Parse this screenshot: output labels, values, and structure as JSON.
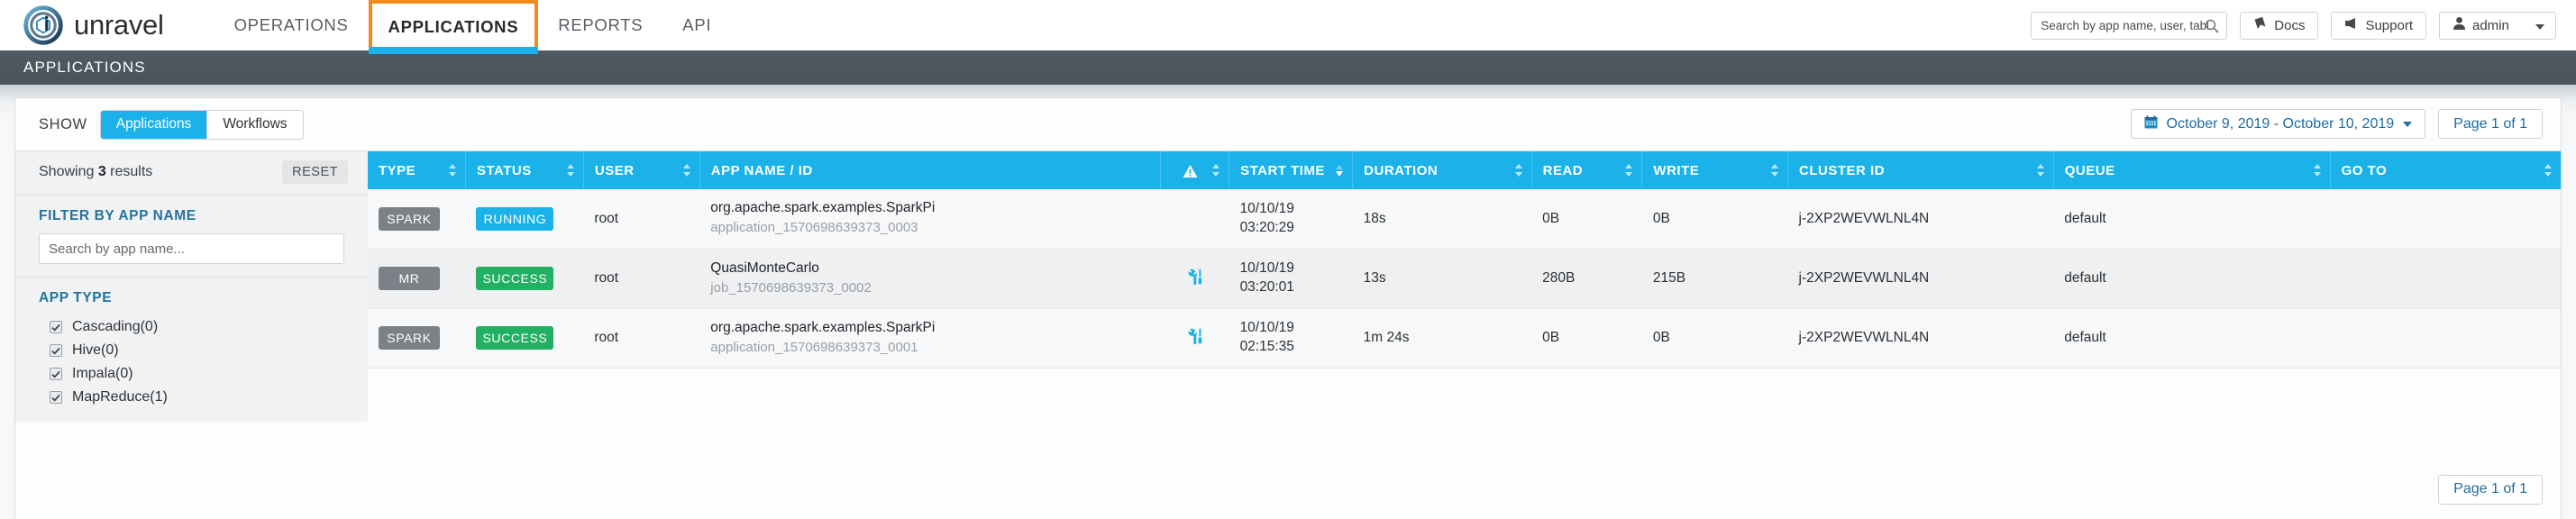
{
  "brand": {
    "name": "unravel",
    "logo_icon": "unravel-logo-icon"
  },
  "topnav": {
    "items": [
      {
        "label": "OPERATIONS",
        "active": false
      },
      {
        "label": "APPLICATIONS",
        "active": true
      },
      {
        "label": "REPORTS",
        "active": false
      },
      {
        "label": "API",
        "active": false
      }
    ],
    "search": {
      "placeholder": "Search by app name, user, table or clust",
      "value": "",
      "icon": "search-icon"
    },
    "docs_button": {
      "label": "Docs",
      "icon": "bookmark-icon"
    },
    "support_button": {
      "label": "Support",
      "icon": "megaphone-icon"
    },
    "user_button": {
      "label": "admin",
      "icon": "user-icon",
      "caret": "chevron-down-icon"
    }
  },
  "page_title": "APPLICATIONS",
  "toolbar": {
    "show_label": "SHOW",
    "segments": [
      {
        "label": "Applications",
        "selected": true
      },
      {
        "label": "Workflows",
        "selected": false
      }
    ],
    "date_range": {
      "label": "October 9, 2019 - October 10, 2019",
      "icon": "calendar-icon",
      "caret": "chevron-down-icon"
    },
    "page_indicator_top": "Page 1 of 1"
  },
  "sidebar": {
    "showing_prefix": "Showing ",
    "showing_count": "3",
    "showing_suffix": " results",
    "reset_label": "RESET",
    "filter_app_name": {
      "heading": "FILTER BY APP NAME",
      "placeholder": "Search by app name...",
      "value": ""
    },
    "app_type": {
      "heading": "APP TYPE",
      "options": [
        {
          "label": "Cascading(0)",
          "checked": true
        },
        {
          "label": "Hive(0)",
          "checked": true
        },
        {
          "label": "Impala(0)",
          "checked": true
        },
        {
          "label": "MapReduce(1)",
          "checked": true
        }
      ]
    }
  },
  "table": {
    "columns": [
      {
        "label": "TYPE",
        "sortable": true,
        "sort": "none"
      },
      {
        "label": "STATUS",
        "sortable": true,
        "sort": "none"
      },
      {
        "label": "USER",
        "sortable": true,
        "sort": "none"
      },
      {
        "label": "APP NAME / ID",
        "sortable": false,
        "sort": "none"
      },
      {
        "label": "",
        "icon": "warning-triangle-icon",
        "sortable": true,
        "sort": "none"
      },
      {
        "label": "START TIME",
        "sortable": true,
        "sort": "desc"
      },
      {
        "label": "DURATION",
        "sortable": true,
        "sort": "none"
      },
      {
        "label": "READ",
        "sortable": true,
        "sort": "none"
      },
      {
        "label": "WRITE",
        "sortable": true,
        "sort": "none"
      },
      {
        "label": "CLUSTER ID",
        "sortable": true,
        "sort": "none"
      },
      {
        "label": "QUEUE",
        "sortable": true,
        "sort": "none"
      },
      {
        "label": "GO TO",
        "sortable": true,
        "sort": "none"
      }
    ],
    "rows": [
      {
        "type": "SPARK",
        "status": "RUNNING",
        "status_kind": "running",
        "user": "root",
        "app_name": "org.apache.spark.examples.SparkPi",
        "app_id": "application_1570698639373_0003",
        "has_tools_icon": false,
        "start_date": "10/10/19",
        "start_time": "03:20:29",
        "duration": "18s",
        "read": "0B",
        "write": "0B",
        "cluster_id": "j-2XP2WEVWLNL4N",
        "queue": "default",
        "go_to": ""
      },
      {
        "type": "MR",
        "status": "SUCCESS",
        "status_kind": "success",
        "user": "root",
        "app_name": "QuasiMonteCarlo",
        "app_id": "job_1570698639373_0002",
        "has_tools_icon": true,
        "start_date": "10/10/19",
        "start_time": "03:20:01",
        "duration": "13s",
        "read": "280B",
        "write": "215B",
        "cluster_id": "j-2XP2WEVWLNL4N",
        "queue": "default",
        "go_to": ""
      },
      {
        "type": "SPARK",
        "status": "SUCCESS",
        "status_kind": "success",
        "user": "root",
        "app_name": "org.apache.spark.examples.SparkPi",
        "app_id": "application_1570698639373_0001",
        "has_tools_icon": true,
        "start_date": "10/10/19",
        "start_time": "02:15:35",
        "duration": "1m 24s",
        "read": "0B",
        "write": "0B",
        "cluster_id": "j-2XP2WEVWLNL4N",
        "queue": "default",
        "go_to": ""
      }
    ]
  },
  "footer": {
    "page_indicator": "Page 1 of 1"
  },
  "colors": {
    "accent_blue": "#1ab2e8",
    "success_green": "#22b062",
    "type_gray": "#7b8187",
    "active_tab_orange": "#f28a1b",
    "link_blue": "#1e6ca3",
    "header_dark": "#4f5a63"
  }
}
